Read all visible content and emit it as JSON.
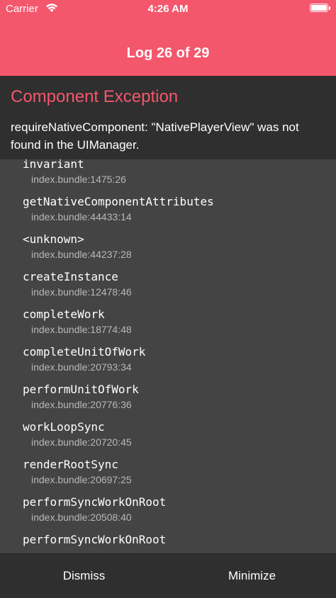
{
  "status_bar": {
    "carrier": "Carrier",
    "time": "4:26 AM"
  },
  "nav": {
    "title": "Log 26 of 29"
  },
  "error": {
    "type": "Component Exception",
    "message": "requireNativeComponent: \"NativePlayerView\" was not found in the UIManager."
  },
  "stack": [
    {
      "fn": "invariant",
      "loc": "index.bundle:1475:26"
    },
    {
      "fn": "getNativeComponentAttributes",
      "loc": "index.bundle:44433:14"
    },
    {
      "fn": "<unknown>",
      "loc": "index.bundle:44237:28"
    },
    {
      "fn": "createInstance",
      "loc": "index.bundle:12478:46"
    },
    {
      "fn": "completeWork",
      "loc": "index.bundle:18774:48"
    },
    {
      "fn": "completeUnitOfWork",
      "loc": "index.bundle:20793:34"
    },
    {
      "fn": "performUnitOfWork",
      "loc": "index.bundle:20776:36"
    },
    {
      "fn": "workLoopSync",
      "loc": "index.bundle:20720:45"
    },
    {
      "fn": "renderRootSync",
      "loc": "index.bundle:20697:25"
    },
    {
      "fn": "performSyncWorkOnRoot",
      "loc": "index.bundle:20508:40"
    },
    {
      "fn": "performSyncWorkOnRoot",
      "loc": ""
    }
  ],
  "footer": {
    "dismiss_label": "Dismiss",
    "minimize_label": "Minimize"
  }
}
